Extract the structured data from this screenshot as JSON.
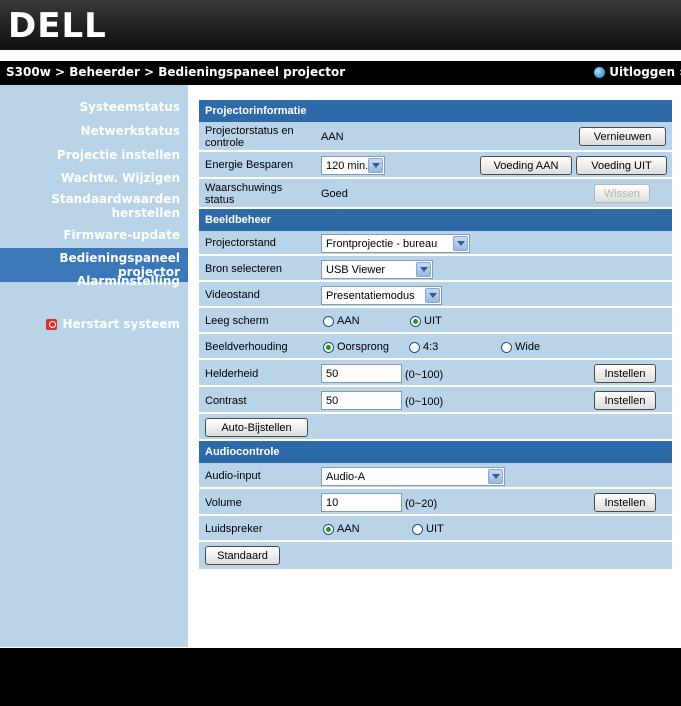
{
  "header": {
    "logo": "DELL",
    "breadcrumb": "S300w > Beheerder > Bedieningspaneel projector",
    "logout": "Uitloggen »"
  },
  "sidebar": {
    "items": [
      {
        "label": "Systeemstatus"
      },
      {
        "label": "Netwerkstatus"
      },
      {
        "label": "Projectie instellen"
      },
      {
        "label": "Wachtw. Wijzigen"
      },
      {
        "label": "Standaardwaarden herstellen"
      },
      {
        "label": "Firmware-update"
      },
      {
        "label": "Bedieningspaneel projector"
      },
      {
        "label": "Alarminstelling"
      }
    ],
    "restart": "Herstart systeem"
  },
  "info": {
    "title": "Projectorinformatie",
    "status_label": "Projectorstatus en controle",
    "status_value": "AAN",
    "refresh": "Vernieuwen",
    "power_saving_label": "Energie Besparen",
    "power_saving_value": "120 min.",
    "power_on": "Voeding AAN",
    "power_off": "Voeding UIT",
    "warning_label": "Waarschuwings status",
    "warning_value": "Goed",
    "clear": "Wissen"
  },
  "image": {
    "title": "Beeldbeheer",
    "mode_label": "Projectorstand",
    "mode_value": "Frontprojectie - bureau",
    "source_label": "Bron selecteren",
    "source_value": "USB Viewer",
    "video_label": "Videostand",
    "video_value": "Presentatiemodus",
    "blank_label": "Leeg scherm",
    "blank_on": "AAN",
    "blank_off": "UIT",
    "aspect_label": "Beeldverhouding",
    "aspect_original": "Oorsprong",
    "aspect_43": "4:3",
    "aspect_wide": "Wide",
    "brightness_label": "Helderheid",
    "brightness_value": "50",
    "brightness_range": "(0~100)",
    "contrast_label": "Contrast",
    "contrast_value": "50",
    "contrast_range": "(0~100)",
    "set": "Instellen",
    "auto_adjust": "Auto-Bijstellen"
  },
  "audio": {
    "title": "Audiocontrole",
    "input_label": "Audio-input",
    "input_value": "Audio-A",
    "volume_label": "Volume",
    "volume_value": "10",
    "volume_range": "(0~20)",
    "set": "Instellen",
    "speaker_label": "Luidspreker",
    "speaker_on": "AAN",
    "speaker_off": "UIT",
    "default": "Standaard"
  }
}
